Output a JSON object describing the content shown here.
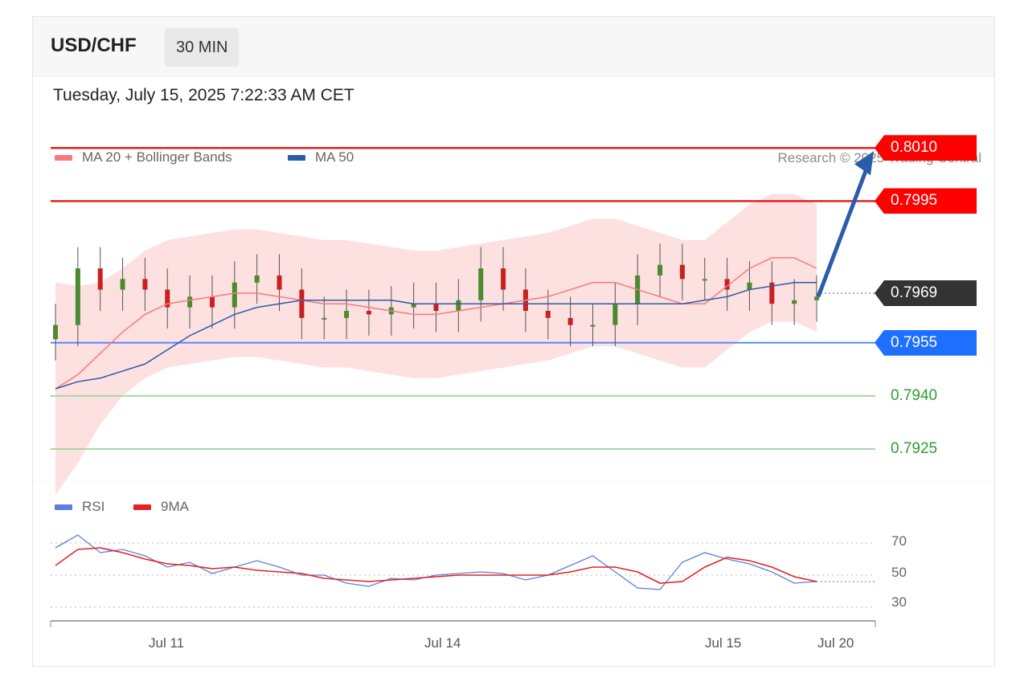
{
  "header": {
    "pair": "USD/CHF",
    "timeframe": "30 MIN"
  },
  "datetime": "Tuesday, July 15, 2025 7:22:33 AM CET",
  "legend": {
    "ma20": "MA 20 + Bollinger Bands",
    "ma50": "MA 50",
    "ma20_color": "#f47c7c",
    "ma50_color": "#2a5ca8"
  },
  "credit": "Research © 2025 Trading Central",
  "rsi_legend": {
    "rsi": "RSI",
    "ma9": "9MA",
    "rsi_color": "#5b7fe0",
    "ma9_color": "#e52222"
  },
  "price_levels": [
    {
      "value": "0.8010",
      "style": "resistance",
      "color": "#ff0000"
    },
    {
      "value": "0.7995",
      "style": "resistance",
      "color": "#ff0000"
    },
    {
      "value": "0.7969",
      "style": "current",
      "color": "#333333"
    },
    {
      "value": "0.7955",
      "style": "pivot",
      "color": "#1f6fff"
    },
    {
      "value": "0.7940",
      "style": "support",
      "color": "#2e9e2e"
    },
    {
      "value": "0.7925",
      "style": "support",
      "color": "#2e9e2e"
    }
  ],
  "rsi_levels": [
    "70",
    "50",
    "30"
  ],
  "x_labels": [
    "Jul 11",
    "Jul 14",
    "Jul 15",
    "Jul 20"
  ],
  "chart_data": [
    {
      "type": "line",
      "title": "",
      "y_axis": "price",
      "ylim": [
        0.792,
        0.8013
      ],
      "levels": [
        0.801,
        0.7995,
        0.7969,
        0.7955,
        0.794,
        0.7925
      ],
      "series": [
        {
          "name": "MA 20 + Bollinger Bands",
          "values": [
            0.7942,
            0.7946,
            0.7952,
            0.7958,
            0.7963,
            0.7966,
            0.7967,
            0.7968,
            0.7969,
            0.7969,
            0.7968,
            0.7967,
            0.7966,
            0.7966,
            0.7965,
            0.7964,
            0.7963,
            0.7963,
            0.7964,
            0.7965,
            0.7966,
            0.7967,
            0.7968,
            0.797,
            0.7972,
            0.7972,
            0.797,
            0.7968,
            0.7966,
            0.7966,
            0.7971,
            0.7976,
            0.7979,
            0.7979,
            0.7976
          ]
        },
        {
          "name": "MA 50",
          "values": [
            0.7942,
            0.7944,
            0.7945,
            0.7947,
            0.7949,
            0.7953,
            0.7957,
            0.796,
            0.7963,
            0.7965,
            0.7966,
            0.7967,
            0.7967,
            0.7967,
            0.7967,
            0.7967,
            0.7966,
            0.7966,
            0.7966,
            0.7966,
            0.7966,
            0.7966,
            0.7966,
            0.7966,
            0.7966,
            0.7966,
            0.7966,
            0.7966,
            0.7966,
            0.7967,
            0.7968,
            0.797,
            0.7971,
            0.7972,
            0.7972
          ]
        }
      ],
      "candles_close": [
        0.796,
        0.7976,
        0.797,
        0.7973,
        0.797,
        0.7965,
        0.7968,
        0.7965,
        0.7972,
        0.7974,
        0.797,
        0.7962,
        0.7962,
        0.7964,
        0.7963,
        0.7965,
        0.7966,
        0.7964,
        0.7967,
        0.7976,
        0.797,
        0.7964,
        0.7962,
        0.796,
        0.796,
        0.7966,
        0.7974,
        0.7977,
        0.7973,
        0.7973,
        0.797,
        0.7972,
        0.7966,
        0.7967,
        0.7968
      ],
      "projection_target": 0.801,
      "x_ticks": [
        "Jul 11",
        "Jul 14",
        "Jul 15",
        "Jul 20"
      ]
    },
    {
      "type": "line",
      "title": "",
      "y_axis": "RSI",
      "ylim": [
        25,
        80
      ],
      "levels": [
        70,
        50,
        30
      ],
      "series": [
        {
          "name": "RSI",
          "values": [
            67,
            75,
            64,
            66,
            62,
            55,
            58,
            51,
            55,
            59,
            55,
            50,
            50,
            45,
            43,
            48,
            47,
            50,
            51,
            52,
            51,
            47,
            50,
            56,
            62,
            52,
            42,
            41,
            58,
            64,
            60,
            57,
            52,
            45,
            46
          ]
        },
        {
          "name": "9MA",
          "values": [
            56,
            66,
            67,
            64,
            60,
            57,
            56,
            54,
            55,
            53,
            52,
            51,
            48,
            47,
            46,
            47,
            48,
            49,
            50,
            50,
            50,
            50,
            50,
            52,
            55,
            55,
            52,
            45,
            46,
            55,
            61,
            59,
            55,
            49,
            46
          ]
        }
      ]
    }
  ]
}
